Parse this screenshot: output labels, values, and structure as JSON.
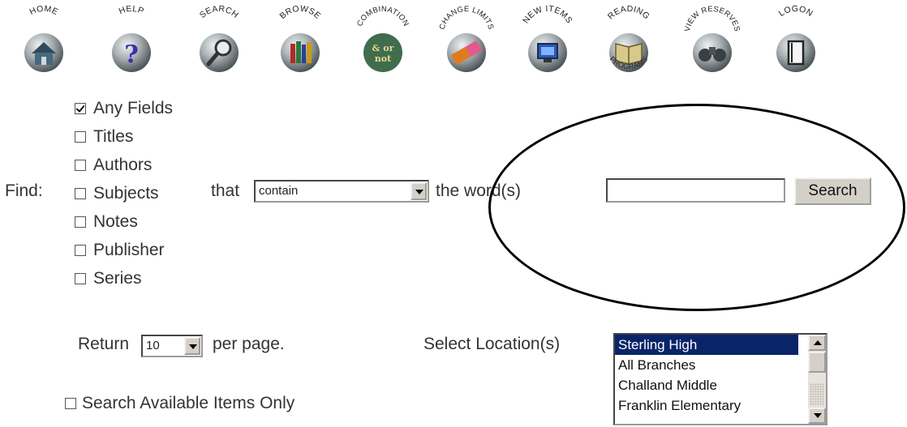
{
  "toolbar": {
    "buttons": [
      {
        "label": "HOME",
        "icon": "home-icon"
      },
      {
        "label": "HELP",
        "icon": "help-icon",
        "glyph": "?"
      },
      {
        "label": "SEARCH",
        "icon": "magnifier-icon"
      },
      {
        "label": "BROWSE",
        "icon": "books-icon"
      },
      {
        "label": "COMBINATION",
        "icon": "combination-icon",
        "glyph_top": "& or",
        "glyph_bottom": "not"
      },
      {
        "label": "CHANGE LIMITS",
        "icon": "eraser-icon"
      },
      {
        "label": "NEW ITEMS",
        "icon": "monitor-icon"
      },
      {
        "label": "READING",
        "label_bottom": "PROGRAMS",
        "icon": "open-book-icon"
      },
      {
        "label": "VIEW RESERVES",
        "icon": "binoculars-icon"
      },
      {
        "label": "LOGON",
        "icon": "door-icon"
      }
    ]
  },
  "search": {
    "find_label": "Find:",
    "fields": [
      {
        "label": "Any Fields",
        "checked": true
      },
      {
        "label": "Titles",
        "checked": false
      },
      {
        "label": "Authors",
        "checked": false
      },
      {
        "label": "Subjects",
        "checked": false
      },
      {
        "label": "Notes",
        "checked": false
      },
      {
        "label": "Publisher",
        "checked": false
      },
      {
        "label": "Series",
        "checked": false
      }
    ],
    "that_label": "that",
    "match_select_value": "contain",
    "words_label": "the word(s)",
    "query_value": "",
    "search_button": "Search"
  },
  "results": {
    "return_label": "Return",
    "per_page_value": "10",
    "per_page_label": "per page.",
    "available_only_label": "Search Available Items Only",
    "available_only_checked": false
  },
  "location": {
    "label": "Select Location(s)",
    "options": [
      "Sterling High",
      "All Branches",
      "Challand Middle",
      "Franklin Elementary"
    ],
    "selected_index": 0
  },
  "colors": {
    "button_face": "#d4d0c8",
    "selection": "#0a246a",
    "icon_ball": "#9aa3a6"
  }
}
